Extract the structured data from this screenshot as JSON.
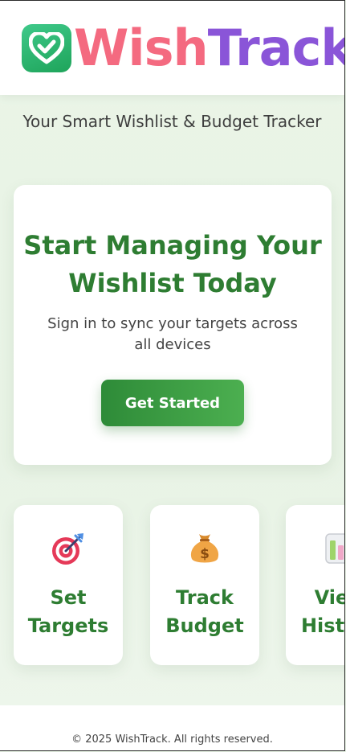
{
  "brand": {
    "name_part1": "Wish",
    "name_part2": "Track",
    "icon": "heart-check-icon",
    "colors": {
      "icon_green": "#22b565",
      "wish_pink": "#f46a80",
      "track_purple": "#8a55d8"
    }
  },
  "tagline": "Your Smart Wishlist & Budget Tracker",
  "hero": {
    "title_line1": "Start Managing Your",
    "title_line2": "Wishlist Today",
    "subtitle": "Sign in to sync your targets across all devices",
    "cta_label": "Get Started"
  },
  "features": [
    {
      "icon": "target-dart-icon",
      "label_line1": "Set",
      "label_line2": "Targets"
    },
    {
      "icon": "money-bag-icon",
      "label_line1": "Track",
      "label_line2": "Budget"
    },
    {
      "icon": "chart-icon",
      "label_line1": "View",
      "label_line2": "History"
    }
  ],
  "footer": {
    "copyright": "© 2025 WishTrack. All rights reserved."
  },
  "theme": {
    "primary_green": "#2e7d32",
    "background": "#e9f4e6"
  }
}
